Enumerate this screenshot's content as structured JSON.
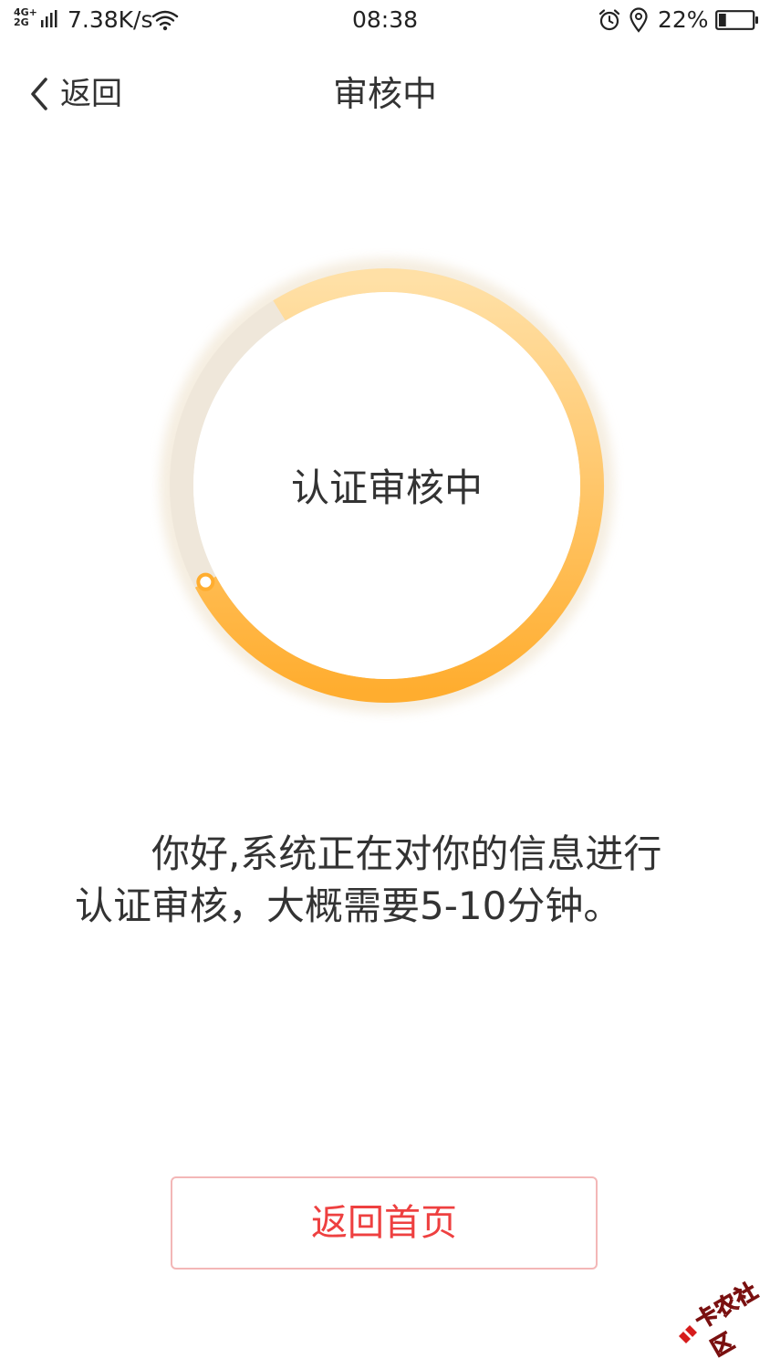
{
  "status_bar": {
    "network_top": "4G+",
    "network_bottom": "2G",
    "net_speed": "7.38K/s",
    "time": "08:38",
    "battery_percent": "22%",
    "battery_level": 0.22
  },
  "nav": {
    "back_label": "返回",
    "title": "审核中"
  },
  "progress": {
    "label": "认证审核中",
    "fraction": 0.76,
    "colors": {
      "track": "#efe7da",
      "arc_start": "#ffad2f",
      "arc_end": "#ffe0a6",
      "knob_fill": "#ffffff"
    }
  },
  "message": {
    "text": "你好,系统正在对你的信息进行认证审核，大概需要5-10分钟。"
  },
  "home_button": {
    "label": "返回首页"
  },
  "watermark": {
    "text": "卡农社区"
  },
  "colors": {
    "accent_red": "#ee4040",
    "button_border": "#f3b7b7",
    "text_dark": "#333333"
  }
}
